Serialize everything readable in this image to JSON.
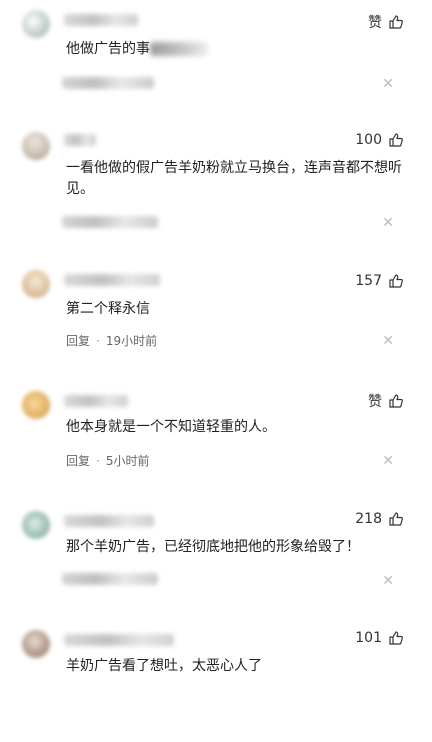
{
  "comments": [
    {
      "like_count": "赞",
      "text": "他做广告的事",
      "reply_label": "",
      "time": "",
      "avatar_color": "#b7c9c5"
    },
    {
      "like_count": "100",
      "text": "一看他做的假广告羊奶粉就立马换台，连声音都不想听见。",
      "reply_label": "",
      "time": "",
      "avatar_color": "#c4b7a5"
    },
    {
      "like_count": "157",
      "text": "第二个释永信",
      "reply_label": "回复",
      "time": "19小时前",
      "avatar_color": "#d8b98f"
    },
    {
      "like_count": "赞",
      "text": "他本身就是一个不知道轻重的人。",
      "reply_label": "回复",
      "time": "5小时前",
      "avatar_color": "#e0a84c"
    },
    {
      "like_count": "218",
      "text": "那个羊奶广告，已经彻底地把他的形象给毁了！",
      "reply_label": "",
      "time": "",
      "avatar_color": "#8fb7a9"
    },
    {
      "like_count": "101",
      "text": "羊奶广告看了想吐，太恶心人了",
      "reply_label": "",
      "time": "",
      "avatar_color": "#a88b7a"
    }
  ],
  "icons": {
    "thumb_up": "thumb-up-icon",
    "close": "close-icon"
  }
}
